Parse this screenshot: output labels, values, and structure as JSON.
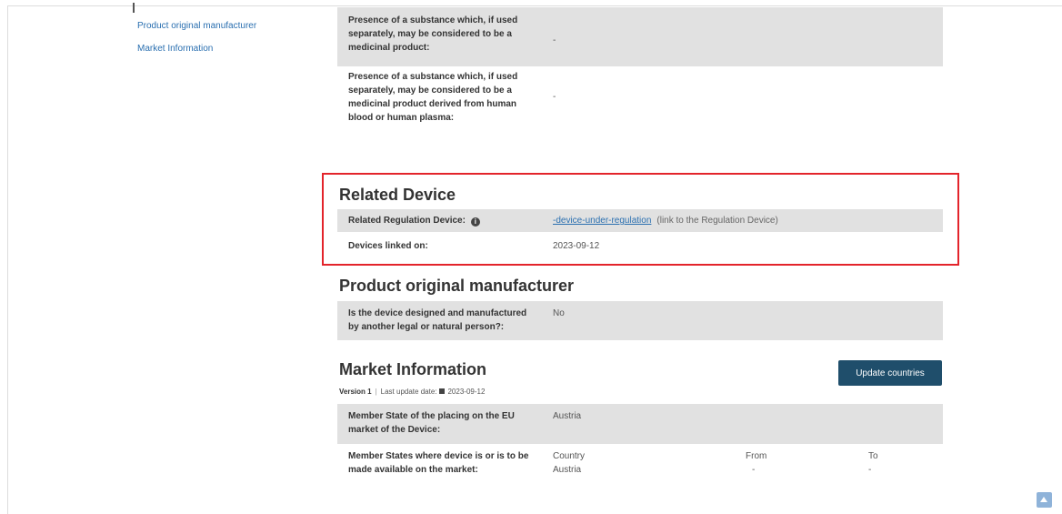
{
  "sidebar": {
    "items": [
      {
        "label": "Product original manufacturer"
      },
      {
        "label": "Market Information"
      }
    ]
  },
  "substances": {
    "medicinal_label": "Presence of a substance which, if used separately, may be considered to be a medicinal product:",
    "medicinal_value": "-",
    "blood_label": "Presence of a substance which, if used separately, may be considered to be a medicinal product derived from human blood or human plasma:",
    "blood_value": "-"
  },
  "related_device": {
    "title": "Related Device",
    "regulation_label": "Related Regulation Device:",
    "regulation_link": "-device-under-regulation",
    "regulation_hint": "(link to the Regulation Device)",
    "linked_label": "Devices linked on:",
    "linked_value": "2023-09-12"
  },
  "manufacturer": {
    "title": "Product original manufacturer",
    "question_label": "Is the device designed and manufactured by another legal or natural person?:",
    "question_value": "No"
  },
  "market": {
    "title": "Market Information",
    "update_button": "Update countries",
    "version": "Version 1",
    "last_update_label": "Last update date:",
    "last_update_value": "2023-09-12",
    "member_state_label": "Member State of the placing on the EU market of the Device:",
    "member_state_value": "Austria",
    "available_label": "Member States where device is or is to be made available on the market:",
    "columns": [
      "Country",
      "From",
      "To"
    ],
    "rows": [
      [
        "Austria",
        "-",
        "-"
      ]
    ]
  },
  "colors": {
    "highlight": "#e3242b",
    "button": "#1f4e6b",
    "link": "#2a6fb0",
    "row_shade": "#e1e1e1"
  },
  "icons": [
    "info-icon",
    "calendar-icon",
    "scroll-to-top-icon"
  ]
}
